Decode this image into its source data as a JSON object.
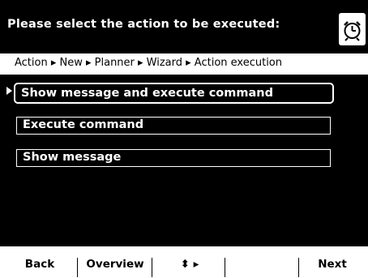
{
  "header": {
    "title": "Please select the action to be executed:",
    "icon": "alarm-clock-icon"
  },
  "breadcrumb": {
    "path": "Action ▸ New ▸ Planner ▸ Wizard ▸ Action execution"
  },
  "options": [
    {
      "label": "Show message and execute command",
      "selected": true
    },
    {
      "label": "Execute command",
      "selected": false
    },
    {
      "label": "Show message",
      "selected": false
    }
  ],
  "softkeys": {
    "back": "Back",
    "overview": "Overview",
    "navigate": "⬍ ▸",
    "empty": "",
    "next": "Next"
  },
  "colors": {
    "background": "#000000",
    "foreground": "#ffffff"
  }
}
